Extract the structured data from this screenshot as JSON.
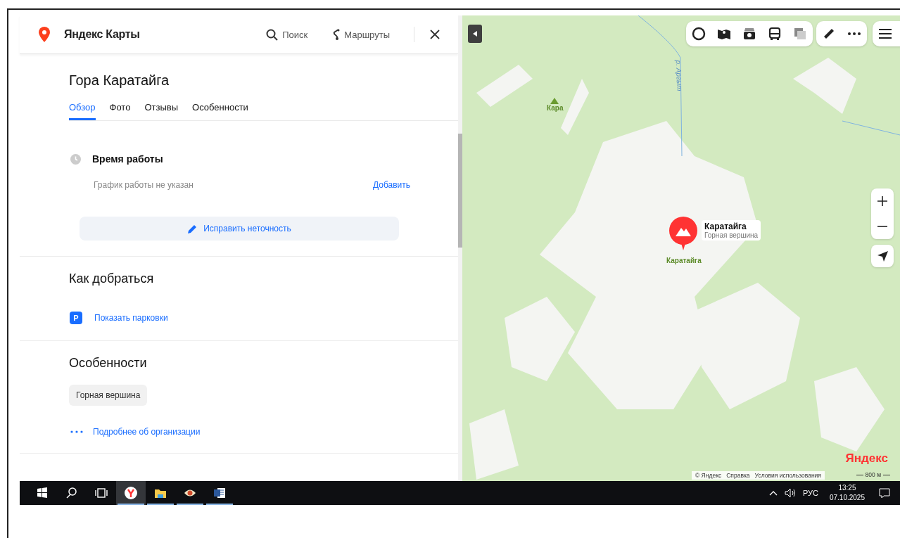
{
  "header": {
    "logo": "Яндекс Карты",
    "search": "Поиск",
    "routes": "Маршруты"
  },
  "place": {
    "title": "Гора Каратайга",
    "tabs": [
      {
        "label": "Обзор",
        "selected": true
      },
      {
        "label": "Фото",
        "selected": false
      },
      {
        "label": "Отзывы",
        "selected": false
      },
      {
        "label": "Особенности",
        "selected": false
      }
    ]
  },
  "hours": {
    "title": "Время работы",
    "note": "График работы не указан",
    "action": "Добавить"
  },
  "fix_button": "Исправить неточность",
  "directions": {
    "title": "Как добраться",
    "parking_icon": "P",
    "parking": "Показать парковки"
  },
  "features": {
    "title": "Особенности",
    "tags": [
      "Горная вершина"
    ],
    "more": "Подробнее об организации"
  },
  "map": {
    "river": "р. Аргыт",
    "peak_labels": [
      "Кара",
      "Каратайга"
    ],
    "callout": {
      "title": "Каратайга",
      "subtitle": "Горная вершина"
    },
    "logo": "Яндекс",
    "footer_links": [
      "© Яндекс",
      "Справка",
      "Условия использования"
    ],
    "scale": "800 м"
  },
  "taskbar": {
    "apps": [
      {
        "kind": "browser",
        "active": true
      },
      {
        "kind": "folder",
        "active": false
      },
      {
        "kind": "eye",
        "active": false
      },
      {
        "kind": "word",
        "active": false
      }
    ],
    "language": "РУС",
    "time": "13:25",
    "date": "07.10.2025"
  }
}
